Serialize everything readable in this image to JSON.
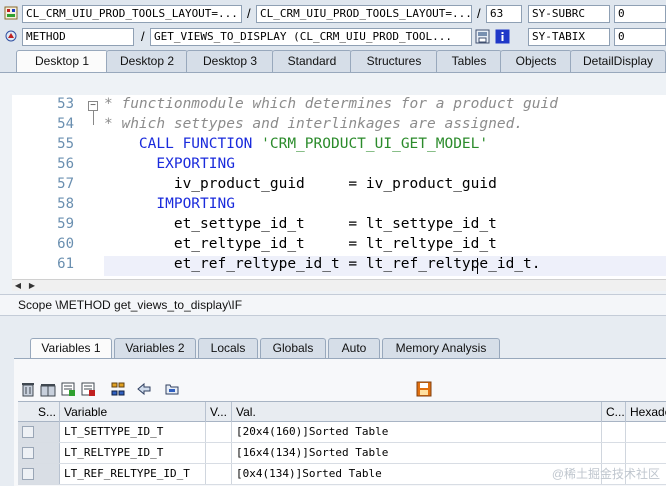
{
  "info": {
    "row1": {
      "class_field": "CL_CRM_UIU_PROD_TOOLS_LAYOUT=...",
      "class_field2": "CL_CRM_UIU_PROD_TOOLS_LAYOUT=...",
      "line_no": "63",
      "sysvar": "SY-SUBRC",
      "sysval": "0"
    },
    "row2": {
      "type": "METHOD",
      "method": "GET_VIEWS_TO_DISPLAY (CL_CRM_UIU_PROD_TOOL...",
      "sysvar": "SY-TABIX",
      "sysval": "0"
    }
  },
  "tabs": [
    "Desktop 1",
    "Desktop 2",
    "Desktop 3",
    "Standard",
    "Structures",
    "Tables",
    "Objects",
    "DetailDisplay"
  ],
  "editor": {
    "lines": [
      {
        "no": "53",
        "parts": [
          {
            "c": "cmt",
            "t": "* functionmodule which determines for a product guid"
          }
        ]
      },
      {
        "no": "54",
        "parts": [
          {
            "c": "cmt",
            "t": "* which settypes and interlinkages are assigned."
          }
        ]
      },
      {
        "no": "55",
        "parts": [
          {
            "c": "kw",
            "t": "    CALL FUNCTION "
          },
          {
            "c": "str",
            "t": "'CRM_PRODUCT_UI_GET_MODEL'"
          }
        ]
      },
      {
        "no": "56",
        "parts": [
          {
            "c": "kw",
            "t": "      EXPORTING"
          }
        ]
      },
      {
        "no": "57",
        "parts": [
          {
            "c": "txt",
            "t": "        iv_product_guid     = iv_product_guid"
          }
        ]
      },
      {
        "no": "58",
        "parts": [
          {
            "c": "kw",
            "t": "      IMPORTING"
          }
        ]
      },
      {
        "no": "59",
        "parts": [
          {
            "c": "txt",
            "t": "        et_settype_id_t     = lt_settype_id_t"
          }
        ]
      },
      {
        "no": "60",
        "parts": [
          {
            "c": "txt",
            "t": "        et_reltype_id_t     = lt_reltype_id_t"
          }
        ]
      },
      {
        "no": "61",
        "parts": [
          {
            "c": "txt",
            "t": "        et_ref_reltype_id_t = lt_ref_reltype_id_t."
          }
        ]
      }
    ]
  },
  "scope": "Scope \\METHOD get_views_to_display\\IF",
  "lower_tabs": [
    "Variables 1",
    "Variables 2",
    "Locals",
    "Globals",
    "Auto",
    "Memory Analysis"
  ],
  "grid": {
    "headers": [
      "S...",
      "Variable",
      "V...",
      "Val.",
      "C...",
      "Hexade"
    ],
    "rows": [
      {
        "variable": "LT_SETTYPE_ID_T",
        "value": "[20x4(160)]Sorted Table"
      },
      {
        "variable": "LT_RELTYPE_ID_T",
        "value": "[16x4(134)]Sorted Table"
      },
      {
        "variable": "LT_REF_RELTYPE_ID_T",
        "value": "[0x4(134)]Sorted Table"
      }
    ]
  },
  "watermark": "@稀土掘金技术社区"
}
